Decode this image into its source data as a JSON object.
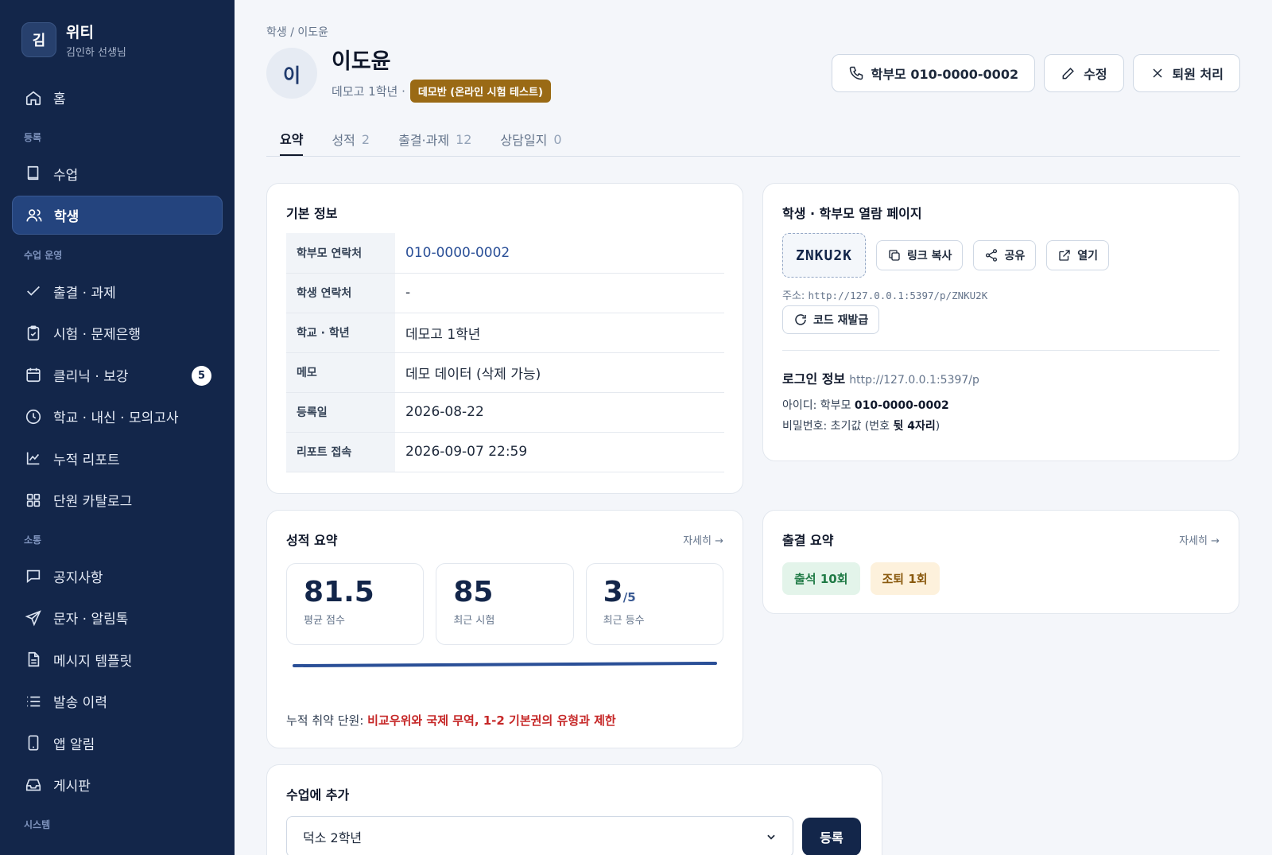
{
  "brand": {
    "logo": "김",
    "title": "위티",
    "subtitle": "김인하 선생님"
  },
  "sidebar": {
    "home": "홈",
    "sec_register": "등록",
    "class": "수업",
    "student": "학생",
    "sec_ops": "수업 운영",
    "attendance": "출결 · 과제",
    "exam": "시험 · 문제은행",
    "clinic": "클리닉 · 보강",
    "clinic_badge": "5",
    "school": "학교 · 내신 · 모의고사",
    "report": "누적 리포트",
    "unit": "단원 카탈로그",
    "sec_comm": "소통",
    "notice": "공지사항",
    "sms": "문자 · 알림톡",
    "template": "메시지 템플릿",
    "history": "발송 이력",
    "app": "앱 알림",
    "board": "게시판",
    "sec_system": "시스템"
  },
  "breadcrumb": "학생 / 이도윤",
  "student": {
    "avatar": "이",
    "name": "이도윤",
    "school_grade": "데모고 1학년 ·",
    "class_tag": "데모반 (온라인 시험 테스트)"
  },
  "actions": {
    "call": "학부모 010-0000-0002",
    "edit": "수정",
    "withdraw": "퇴원 처리"
  },
  "tabs": [
    {
      "label": "요약",
      "count": ""
    },
    {
      "label": "성적",
      "count": "2"
    },
    {
      "label": "출결·과제",
      "count": "12"
    },
    {
      "label": "상담일지",
      "count": "0"
    }
  ],
  "basic": {
    "title": "기본 정보",
    "rows": [
      {
        "k": "학부모 연락처",
        "v": "010-0000-0002"
      },
      {
        "k": "학생 연락처",
        "v": "-"
      },
      {
        "k": "학교 · 학년",
        "v": "데모고 1학년"
      },
      {
        "k": "메모",
        "v": "데모 데이터 (삭제 가능)"
      },
      {
        "k": "등록일",
        "v": "2026-08-22"
      },
      {
        "k": "리포트 접속",
        "v": "2026-09-07 22:59"
      }
    ]
  },
  "portal": {
    "title": "학생 · 학부모 열람 페이지",
    "code": "ZNKU2K",
    "copy": "링크 복사",
    "share": "공유",
    "open": "열기",
    "addr_label": "주소:",
    "addr": "http://127.0.0.1:5397/p/ZNKU2K",
    "reissue": "코드 재발급",
    "login_title": "로그인 정보",
    "login_url": "http://127.0.0.1:5397/p",
    "id_label": "아이디: 학부모",
    "id_value": "010-0000-0002",
    "pw_label": "비밀번호: 초기값 (번호",
    "pw_value": "뒷 4자리",
    "pw_end": ")"
  },
  "score": {
    "title": "성적 요약",
    "more": "자세히 →",
    "avg": "81.5",
    "avg_label": "평균 점수",
    "recent": "85",
    "recent_label": "최근 시험",
    "rank": "3",
    "rank_total": "/5",
    "rank_label": "최근 등수",
    "weak_label": "누적 취약 단원:",
    "weak_value": "비교우위와 국제 무역, 1-2 기본권의 유형과 제한"
  },
  "attendance": {
    "title": "출결 요약",
    "more": "자세히 →",
    "present": "출석 10회",
    "early": "조퇴 1회"
  },
  "enroll": {
    "title": "수업에 추가",
    "selected": "덕소 2학년",
    "register": "등록"
  },
  "colors": {
    "sidebar": "#13264a",
    "accent": "#24447e",
    "danger": "#c62828",
    "tag": "#9a6a15"
  }
}
